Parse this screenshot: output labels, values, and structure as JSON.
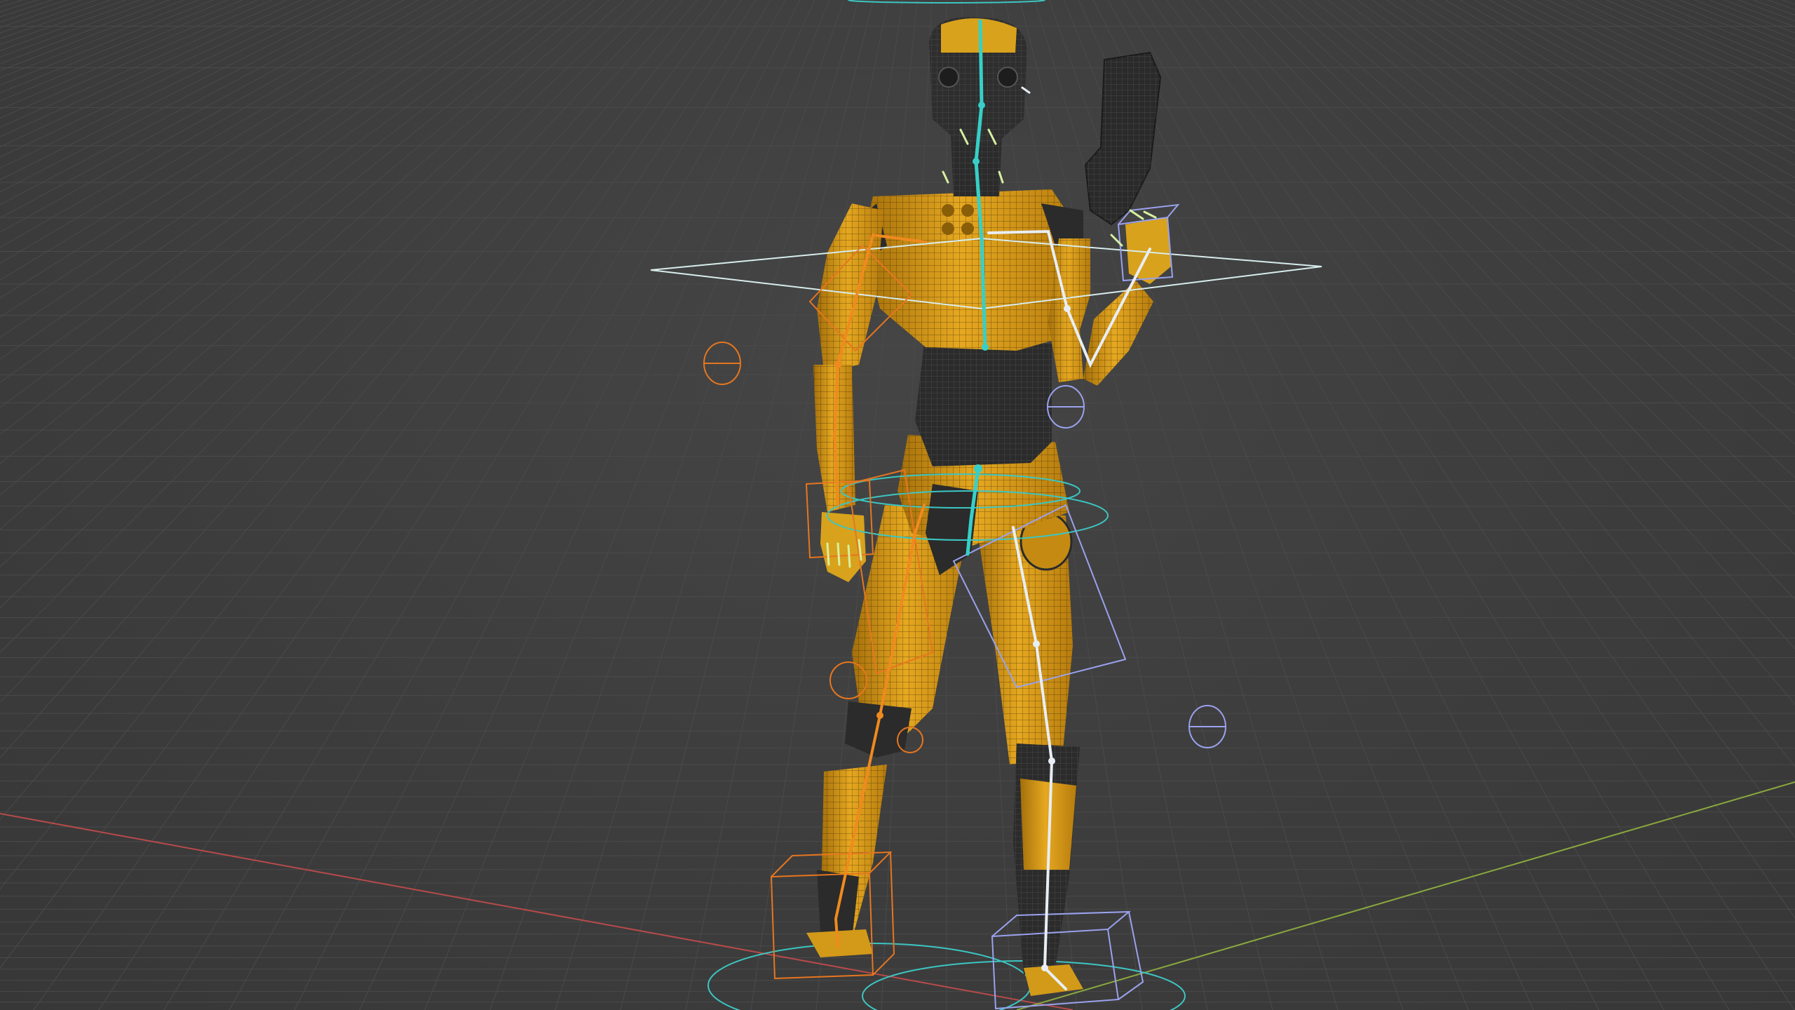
{
  "viewport": {
    "background": "#3d3d3d",
    "grid_color": "#4a4a4a",
    "x_axis_color": "#b84a4a",
    "y_axis_color": "#8aa83e"
  },
  "character": {
    "armor_color": "#e0a41e",
    "armor_shadow": "#a26f0c",
    "body_suit_color": "#2b2b2b",
    "wire_color": "#222222"
  },
  "rig": {
    "spine_bone_color": "#36d0c8",
    "left_bone_color": "#f08a1e",
    "right_bone_color": "#e8eef5",
    "root_control_color": "#3cc6c2",
    "ik_control_color": "#9aa2ee",
    "left_ik_control_color": "#e7761f",
    "chest_control_color": "#d8ecec"
  },
  "weapon": {
    "color": "#2a2a2a",
    "icon": "pistol-icon"
  }
}
